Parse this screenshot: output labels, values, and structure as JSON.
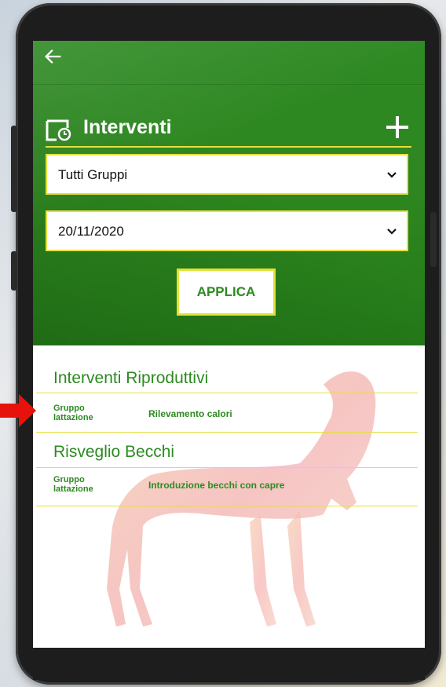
{
  "header": {
    "back_icon": "arrow-left-icon",
    "title": "Interventi",
    "title_icon": "calendar-clock-icon",
    "add_icon": "plus-icon"
  },
  "filters": {
    "group_select": "Tutti Gruppi",
    "date_select": "20/11/2020",
    "apply_label": "APPLICA"
  },
  "sections": [
    {
      "title": "Interventi Riproduttivi",
      "rows": [
        {
          "group": "Gruppo lattazione",
          "description": "Rilevamento calori"
        }
      ]
    },
    {
      "title": "Risveglio Becchi",
      "rows": [
        {
          "group": "Gruppo lattazione",
          "description": "Introduzione becchi con capre"
        }
      ]
    }
  ],
  "colors": {
    "primary_green": "#2d8a22",
    "accent_yellow": "#e6e03a",
    "arrow_red": "#e8120c"
  }
}
